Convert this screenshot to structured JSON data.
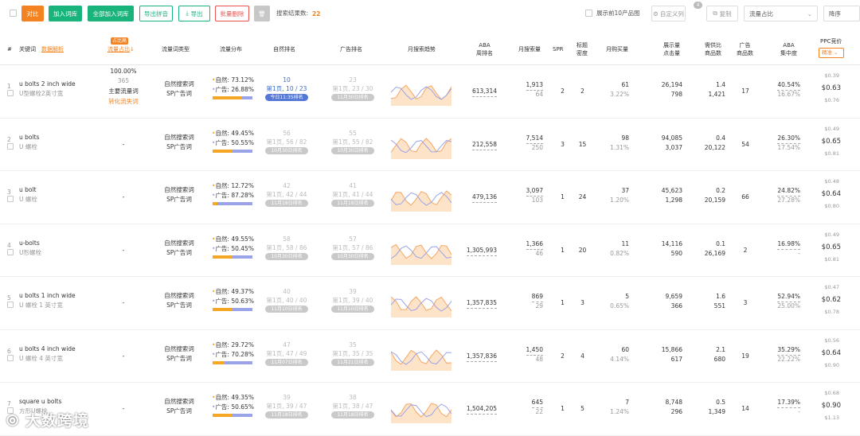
{
  "toolbar": {
    "compare": "对比",
    "add_lib": "加入词库",
    "add_all_lib": "全部加入词库",
    "export_pinyin": "导出拼音",
    "export": "导出",
    "batch_delete": "批量删除",
    "result_label": "搜索结果数:",
    "result_count": "22",
    "show_top10": "展示前10产品图",
    "custom_cols": "自定义列",
    "custom_badge": "4",
    "copy": "复制",
    "sort_field": "流量占比",
    "sort_order": "降序"
  },
  "header": {
    "idx": "#",
    "keyword": "关键词",
    "keyword_tip": "数据解析",
    "traffic_share": "流量占比",
    "traffic_badge": "占比高",
    "traffic_type": "流量词类型",
    "traffic_dist": "流量分布",
    "natural_rank": "自然排名",
    "ad_rank": "广告排名",
    "trend": "月搜索趋势",
    "aba_rank": "ABA\n周排名",
    "monthly_search": "月搜索量",
    "spr": "SPR",
    "title_density": "标题\n密度",
    "monthly_buy": "月购买量",
    "impressions": "展示量\n点击量",
    "supply_demand": "需供比\n商品数",
    "ad_products": "广告\n商品数",
    "aba_conc": "ABA\n集中度",
    "ppc": "PPC竞价",
    "ppc_select": "精准"
  },
  "rows": [
    {
      "idx": "1",
      "kw": "u bolts 2 inch wide",
      "kw_cn": "U型螺栓2英寸宽",
      "share": "100.00%",
      "share2": "365",
      "share3": "主要流量词",
      "share4": "转化流失词",
      "type1": "自然搜索词",
      "type2": "SP广告词",
      "nat_pct": "73.12%",
      "ad_pct": "26.88%",
      "nat_frac": 0.7312,
      "nr1": "10",
      "nr2": "第1页, 10 / 23",
      "nr3": "今日11:35排名",
      "nr_active": true,
      "ar1": "23",
      "ar2": "第1页, 23 / 30",
      "ar3": "11月30日排名",
      "aba": "613,314",
      "ms1": "1,913",
      "ms2": "64",
      "spr": "2",
      "td": "2",
      "mb1": "61",
      "mb2": "3.22%",
      "im1": "26,194",
      "im2": "798",
      "sd1": "1.4",
      "sd2": "1,421",
      "adp": "17",
      "ac1": "40.54%",
      "ac2": "16.67%",
      "p1": "$0.39",
      "p2": "$0.63",
      "p3": "$0.76"
    },
    {
      "idx": "2",
      "kw": "u bolts",
      "kw_cn": "U 螺栓",
      "share": "-",
      "share2": "",
      "share3": "",
      "share4": "",
      "type1": "自然搜索词",
      "type2": "SP广告词",
      "nat_pct": "49.45%",
      "ad_pct": "50.55%",
      "nat_frac": 0.4945,
      "nr1": "56",
      "nr2": "第1页, 56 / 82",
      "nr3": "10月30日排名",
      "nr_active": false,
      "ar1": "55",
      "ar2": "第1页, 55 / 82",
      "ar3": "10月30日排名",
      "aba": "212,558",
      "ms1": "7,514",
      "ms2": "250",
      "spr": "3",
      "td": "15",
      "mb1": "98",
      "mb2": "1.31%",
      "im1": "94,085",
      "im2": "3,037",
      "sd1": "0.4",
      "sd2": "20,122",
      "adp": "54",
      "ac1": "26.30%",
      "ac2": "17.54%",
      "p1": "$0.49",
      "p2": "$0.65",
      "p3": "$0.81"
    },
    {
      "idx": "3",
      "kw": "u bolt",
      "kw_cn": "U 螺栓",
      "share": "-",
      "share2": "",
      "share3": "",
      "share4": "",
      "type1": "自然搜索词",
      "type2": "SP广告词",
      "nat_pct": "12.72%",
      "ad_pct": "87.28%",
      "nat_frac": 0.1272,
      "nr1": "42",
      "nr2": "第1页, 42 / 44",
      "nr3": "11月18日排名",
      "nr_active": false,
      "ar1": "41",
      "ar2": "第1页, 41 / 44",
      "ar3": "11月18日排名",
      "aba": "479,136",
      "ms1": "3,097",
      "ms2": "103",
      "spr": "1",
      "td": "24",
      "mb1": "37",
      "mb2": "1.20%",
      "im1": "45,623",
      "im2": "1,298",
      "sd1": "0.2",
      "sd2": "20,159",
      "adp": "66",
      "ac1": "24.82%",
      "ac2": "27.28%",
      "p1": "$0.48",
      "p2": "$0.64",
      "p3": "$0.80"
    },
    {
      "idx": "4",
      "kw": "u-bolts",
      "kw_cn": "U形螺栓",
      "share": "-",
      "share2": "",
      "share3": "",
      "share4": "",
      "type1": "自然搜索词",
      "type2": "SP广告词",
      "nat_pct": "49.55%",
      "ad_pct": "50.45%",
      "nat_frac": 0.4955,
      "nr1": "58",
      "nr2": "第1页, 58 / 86",
      "nr3": "10月30日排名",
      "nr_active": false,
      "ar1": "57",
      "ar2": "第1页, 57 / 86",
      "ar3": "10月30日排名",
      "aba": "1,305,993",
      "ms1": "1,366",
      "ms2": "46",
      "spr": "1",
      "td": "20",
      "mb1": "11",
      "mb2": "0.82%",
      "im1": "14,116",
      "im2": "590",
      "sd1": "0.1",
      "sd2": "26,169",
      "adp": "2",
      "ac1": "16.98%",
      "ac2": "-",
      "p1": "$0.49",
      "p2": "$0.65",
      "p3": "$0.81"
    },
    {
      "idx": "5",
      "kw": "u bolts 1 inch wide",
      "kw_cn": "U 螺栓 1 英寸宽",
      "share": "-",
      "share2": "",
      "share3": "",
      "share4": "",
      "type1": "自然搜索词",
      "type2": "SP广告词",
      "nat_pct": "49.37%",
      "ad_pct": "50.63%",
      "nat_frac": 0.4937,
      "nr1": "40",
      "nr2": "第1页, 40 / 40",
      "nr3": "11月10日排名",
      "nr_active": false,
      "ar1": "39",
      "ar2": "第1页, 39 / 40",
      "ar3": "11月10日排名",
      "aba": "1,357,835",
      "ms1": "869",
      "ms2": "29",
      "spr": "1",
      "td": "3",
      "mb1": "5",
      "mb2": "0.65%",
      "im1": "9,659",
      "im2": "366",
      "sd1": "1.6",
      "sd2": "551",
      "adp": "3",
      "ac1": "52.94%",
      "ac2": "25.00%",
      "p1": "$0.47",
      "p2": "$0.62",
      "p3": "$0.78"
    },
    {
      "idx": "6",
      "kw": "u bolts 4 inch wide",
      "kw_cn": "U 螺栓 4 英寸宽",
      "share": "-",
      "share2": "",
      "share3": "",
      "share4": "",
      "type1": "自然搜索词",
      "type2": "SP广告词",
      "nat_pct": "29.72%",
      "ad_pct": "70.28%",
      "nat_frac": 0.2972,
      "nr1": "47",
      "nr2": "第1页, 47 / 49",
      "nr3": "11月07日排名",
      "nr_active": false,
      "ar1": "35",
      "ar2": "第1页, 35 / 35",
      "ar3": "11月21日排名",
      "aba": "1,357,836",
      "ms1": "1,450",
      "ms2": "48",
      "spr": "2",
      "td": "4",
      "mb1": "60",
      "mb2": "4.14%",
      "im1": "15,866",
      "im2": "617",
      "sd1": "2.1",
      "sd2": "680",
      "adp": "19",
      "ac1": "35.29%",
      "ac2": "22.22%",
      "p1": "$0.56",
      "p2": "$0.64",
      "p3": "$0.90"
    },
    {
      "idx": "7",
      "kw": "square u bolts",
      "kw_cn": "方形U螺栓",
      "share": "-",
      "share2": "",
      "share3": "",
      "share4": "",
      "type1": "自然搜索词",
      "type2": "SP广告词",
      "nat_pct": "49.35%",
      "ad_pct": "50.65%",
      "nat_frac": 0.4935,
      "nr1": "39",
      "nr2": "第1页, 39 / 47",
      "nr3": "11月18日排名",
      "nr_active": false,
      "ar1": "38",
      "ar2": "第1页, 38 / 47",
      "ar3": "11月18日排名",
      "aba": "1,504,205",
      "ms1": "645",
      "ms2": "22",
      "spr": "1",
      "td": "5",
      "mb1": "7",
      "mb2": "1.24%",
      "im1": "8,748",
      "im2": "296",
      "sd1": "0.5",
      "sd2": "1,349",
      "adp": "14",
      "ac1": "17.39%",
      "ac2": "-",
      "p1": "$0.68",
      "p2": "$0.90",
      "p3": "$1.13"
    }
  ],
  "labels": {
    "natural": "自然:",
    "ad": "广告:"
  },
  "watermark": "大数跨境",
  "colors": {
    "orange": "#f58220",
    "green": "#19b37c",
    "red": "#e8534f",
    "blue": "#3d6cc8"
  }
}
